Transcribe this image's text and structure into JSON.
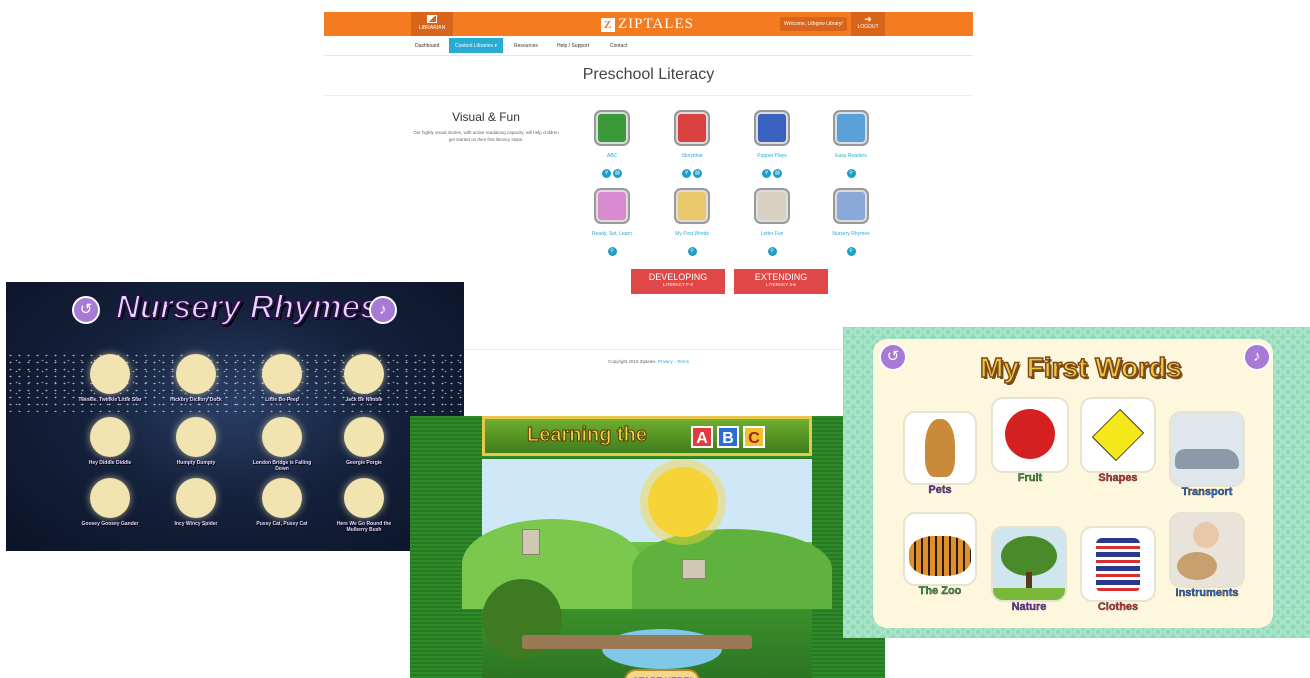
{
  "ziptales": {
    "librarian_label": "LIBRARIAN",
    "logo": "ZIPTALES",
    "logo_mark": "Z",
    "welcome": "Welcome, Lithgow Library!",
    "logout": "LOGOUT",
    "nav": [
      "Dashboard",
      "Content Libraries",
      "Resources",
      "Help / Support",
      "Contact"
    ],
    "page_title": "Preschool Literacy",
    "section_title": "Visual & Fun",
    "section_desc": "Our highly visual stories, with active readalong capacity, will help children get started on their first literacy steps.",
    "tiles": [
      {
        "label": "ABC",
        "color": "#3a9a3a"
      },
      {
        "label": "Storytime",
        "color": "#d94040"
      },
      {
        "label": "Puppet Plays",
        "color": "#3a60c0"
      },
      {
        "label": "Easy Readers",
        "color": "#5aa0d8"
      },
      {
        "label": "Ready, Set, Learn",
        "color": "#d98ad0"
      },
      {
        "label": "My First Words",
        "color": "#e8c86a"
      },
      {
        "label": "Letter Fun",
        "color": "#d8d0c0"
      },
      {
        "label": "Nursery Rhymes",
        "color": "#8aa8d8"
      }
    ],
    "level_buttons": [
      {
        "title": "DEVELOPING",
        "sub": "LITERACY F-2"
      },
      {
        "title": "EXTENDING",
        "sub": "LITERACY 3-6"
      }
    ],
    "footer_text": "Copyright 2019 Ziptales.",
    "footer_privacy": "Privacy",
    "footer_sep": "-",
    "footer_terms": "Terms"
  },
  "nursery": {
    "title": "Nursery Rhymes",
    "items": [
      "Twinkle, Twinkle Little Star",
      "Hickory Dickory Dock",
      "Little Bo-Peep",
      "Jack Be Nimble",
      "Hey Diddle Diddle",
      "Humpty Dumpty",
      "London Bridge is Falling Down",
      "Georgie Porgie",
      "Goosey Goosey Gander",
      "Incy Wincy Spider",
      "Pussy Cat, Pussy Cat",
      "Here We Go Round the Mulberry Bush"
    ]
  },
  "abc": {
    "title": "Learning the",
    "blocks": [
      {
        "letter": "A",
        "color": "#e23b3b"
      },
      {
        "letter": "B",
        "color": "#2b6fd0"
      },
      {
        "letter": "C",
        "color": "#f0c030"
      }
    ],
    "start": "START HERE!"
  },
  "first_words": {
    "title": "My First Words",
    "tiles": [
      {
        "label": "Pets",
        "color": "#7a2ab8",
        "bg": "#c98a3a"
      },
      {
        "label": "Fruit",
        "color": "#3aa83a",
        "bg": "#d42020"
      },
      {
        "label": "Shapes",
        "color": "#d83030",
        "bg": "#f5e81a"
      },
      {
        "label": "Transport",
        "color": "#2a6ad0",
        "bg": "#8a9aa8"
      },
      {
        "label": "The Zoo",
        "color": "#3aa83a",
        "bg": "#e0902a"
      },
      {
        "label": "Nature",
        "color": "#7a2ab8",
        "bg": "#4a8a2a"
      },
      {
        "label": "Clothes",
        "color": "#d83030",
        "bg": "#2a3a8a"
      },
      {
        "label": "Instruments",
        "color": "#2a6ad0",
        "bg": "#c8a070"
      }
    ]
  }
}
